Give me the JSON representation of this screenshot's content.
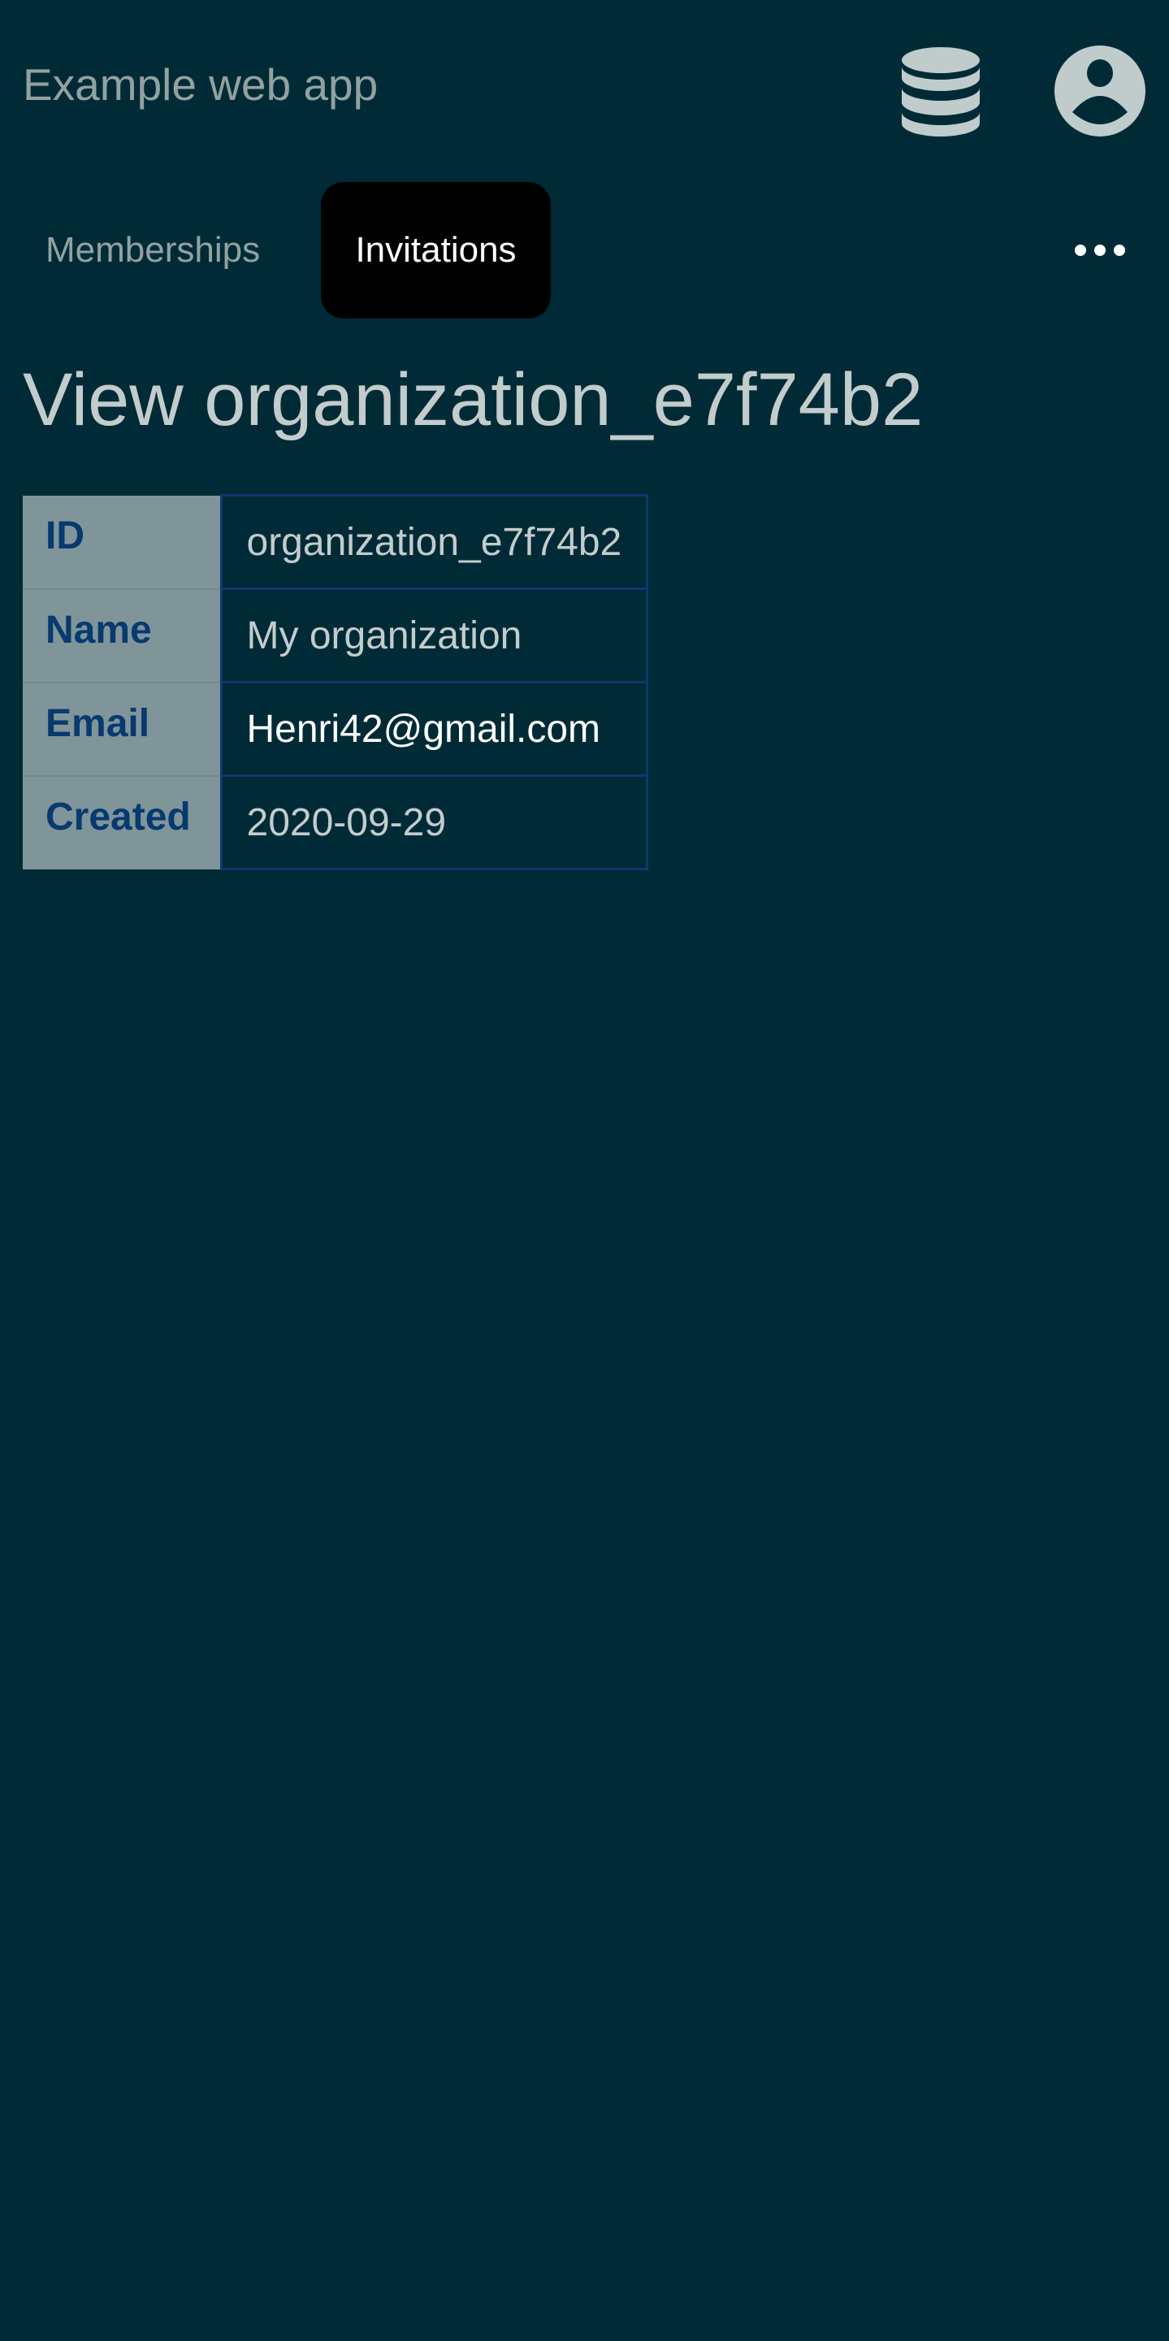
{
  "header": {
    "title": "Example web app",
    "icons": [
      "database-icon",
      "user-circle-icon"
    ]
  },
  "tabs": [
    {
      "label": "Memberships",
      "active": false
    },
    {
      "label": "Invitations",
      "active": true
    }
  ],
  "more_icon": "ellipsis-icon",
  "page": {
    "title": "View organization_e7f74b2"
  },
  "details": [
    {
      "label": "ID",
      "value": "organization_e7f74b2"
    },
    {
      "label": "Name",
      "value": "My organization"
    },
    {
      "label": "Email",
      "value": "Henri42@gmail.com"
    },
    {
      "label": "Created",
      "value": "2020-09-29"
    }
  ],
  "colors": {
    "background": "#002b36",
    "active_tab": "#000000",
    "label_bg": "#7f959a",
    "label_text": "#073a6e"
  }
}
